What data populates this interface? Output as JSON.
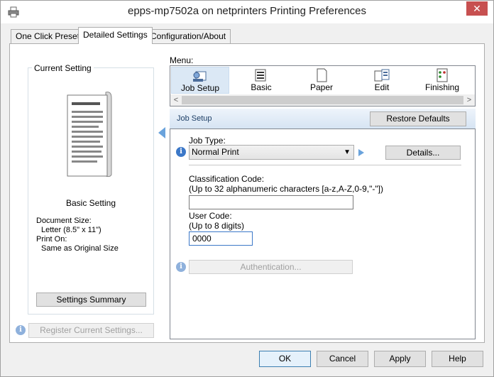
{
  "window": {
    "title": "epps-mp7502a on netprinters Printing Preferences",
    "close_glyph": "✕"
  },
  "tabs": [
    {
      "label": "One Click Presets",
      "active": false
    },
    {
      "label": "Detailed Settings",
      "active": true
    },
    {
      "label": "Configuration/About",
      "active": false
    }
  ],
  "current_setting": {
    "legend": "Current Setting",
    "preset_name": "Basic Setting",
    "document_size_label": "Document Size:",
    "document_size_value": "Letter (8.5\" x 11\")",
    "print_on_label": "Print On:",
    "print_on_value": "Same as Original Size",
    "summary_button": "Settings Summary",
    "register_button": "Register Current Settings..."
  },
  "menu": {
    "label": "Menu:",
    "items": [
      {
        "label": "Job Setup",
        "icon": "job-setup-icon",
        "selected": true
      },
      {
        "label": "Basic",
        "icon": "basic-icon",
        "selected": false
      },
      {
        "label": "Paper",
        "icon": "paper-icon",
        "selected": false
      },
      {
        "label": "Edit",
        "icon": "edit-icon",
        "selected": false
      },
      {
        "label": "Finishing",
        "icon": "finishing-icon",
        "selected": false
      }
    ],
    "scroll_left": "<",
    "scroll_right": ">"
  },
  "job_setup": {
    "header": "Job Setup",
    "restore_button": "Restore Defaults",
    "job_type_label": "Job Type:",
    "job_type_value": "Normal Print",
    "details_button": "Details...",
    "classification_label": "Classification Code:",
    "classification_hint": "(Up to 32 alphanumeric characters [a-z,A-Z,0-9,\"-\"])",
    "classification_value": "",
    "user_code_label": "User Code:",
    "user_code_hint": "(Up to 8 digits)",
    "user_code_value": "0000",
    "authentication_button": "Authentication..."
  },
  "footer": {
    "ok": "OK",
    "cancel": "Cancel",
    "apply": "Apply",
    "help": "Help"
  },
  "colors": {
    "accent": "#3c78c8",
    "close": "#c75050",
    "header_text": "#1e3f66"
  }
}
